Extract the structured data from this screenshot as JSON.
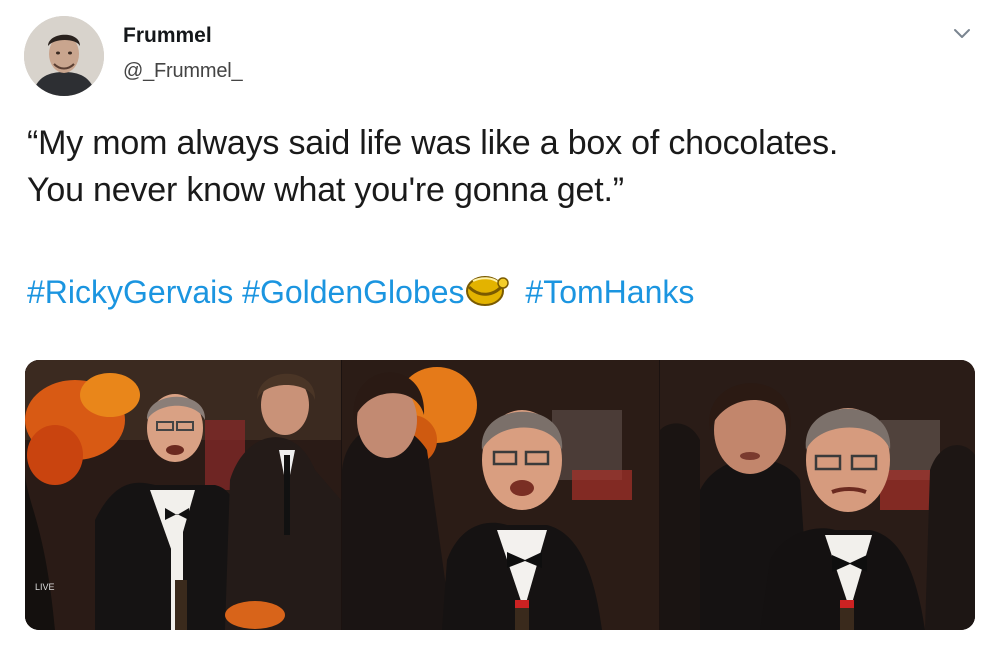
{
  "tweet": {
    "author": {
      "display_name": "Frummel",
      "handle": "@_Frummel_"
    },
    "menu_icon": "chevron-down-icon",
    "text_lines": [
      "“My mom always said life was like a box of chocolates.",
      "You never know what you're gonna get.”"
    ],
    "hashtags": {
      "first": "#RickyGervais",
      "second": "#GoldenGlobes",
      "third": "#TomHanks"
    },
    "emoji_icon": "golden-globe-bell-icon",
    "colors": {
      "link": "#1b95e0",
      "text": "#14171a"
    },
    "media": {
      "frames": 3,
      "overlay_badge": "LIVE"
    }
  }
}
